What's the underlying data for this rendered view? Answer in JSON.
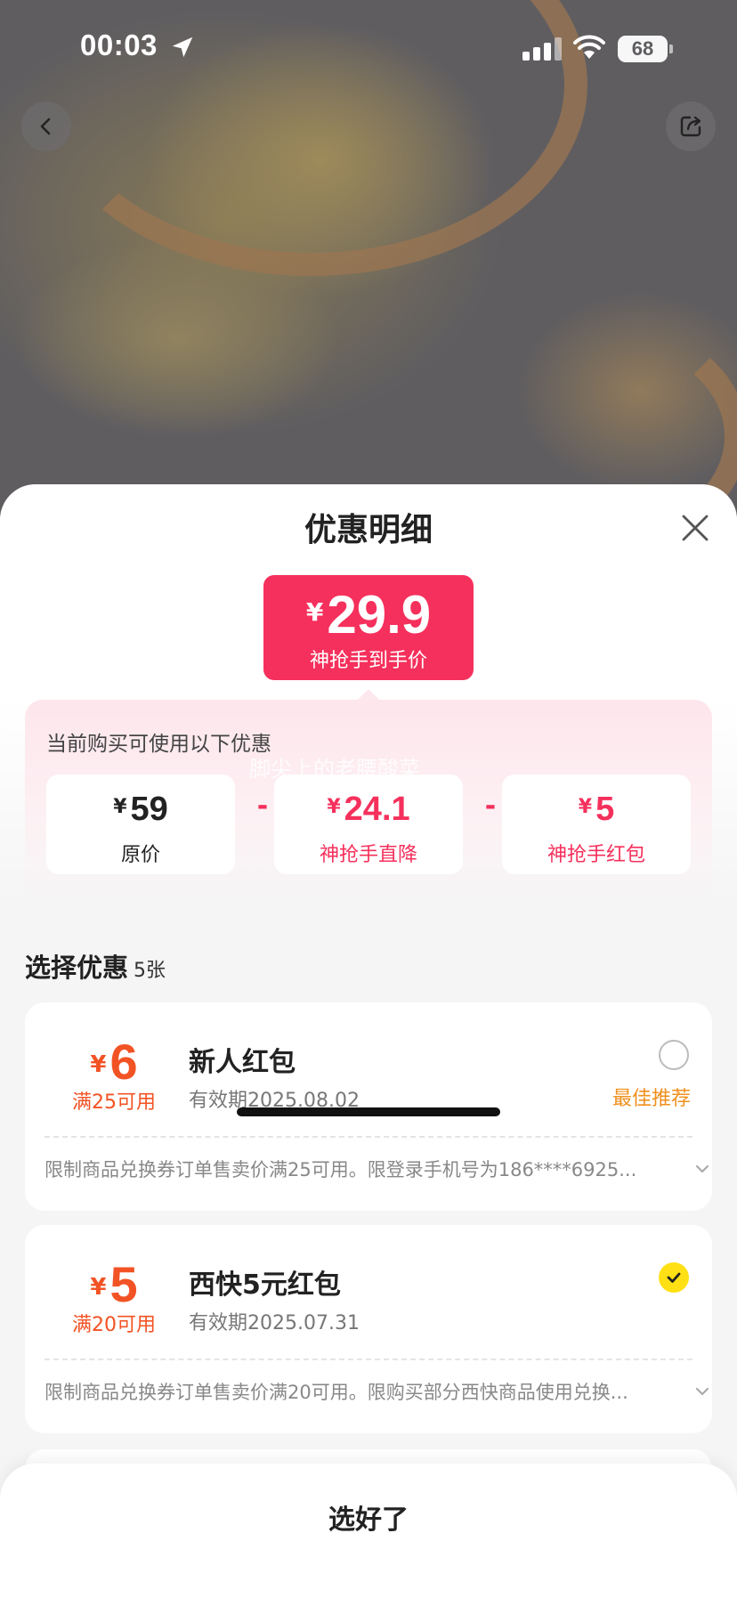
{
  "status_bar": {
    "time": "00:03",
    "battery": "68"
  },
  "sheet": {
    "title": "优惠明细",
    "final_price": {
      "currency": "¥",
      "amount": "29.9",
      "label": "神抢手到手价",
      "color": "#f5305c"
    },
    "discount_panel": {
      "intro": "当前购买可使用以下优惠",
      "watermark": "脚尖上的老腰酸菜",
      "items": [
        {
          "currency": "¥",
          "value": "59",
          "label": "原价"
        },
        {
          "currency": "¥",
          "value": "24.1",
          "label": "神抢手直降"
        },
        {
          "currency": "¥",
          "value": "5",
          "label": "神抢手红包"
        }
      ],
      "operator": "-"
    },
    "choose": {
      "title": "选择优惠",
      "count": "5张"
    },
    "coupons": [
      {
        "currency": "¥",
        "amount": "6",
        "condition": "满25可用",
        "name": "新人红包",
        "validity": "有效期2025.08.02",
        "selected": false,
        "tag": "最佳推荐",
        "rule": "限制商品兑换券订单售卖价满25可用。限登录手机号为186****6925..."
      },
      {
        "currency": "¥",
        "amount": "5",
        "condition": "满20可用",
        "name": "西快5元红包",
        "validity": "有效期2025.07.31",
        "selected": true,
        "tag": "",
        "rule": "限制商品兑换券订单售卖价满20可用。限购买部分西快商品使用兑换..."
      }
    ],
    "confirm_label": "选好了"
  },
  "colors": {
    "accent_pink": "#f5305c",
    "coupon_orange": "#f25325",
    "best_tag": "#f0901e",
    "check_yellow": "#ffe014"
  },
  "icons": [
    "location-arrow-icon",
    "signal-icon",
    "wifi-icon",
    "battery-icon",
    "back-chevron-icon",
    "share-icon",
    "close-icon",
    "check-icon",
    "chevron-down-icon"
  ]
}
